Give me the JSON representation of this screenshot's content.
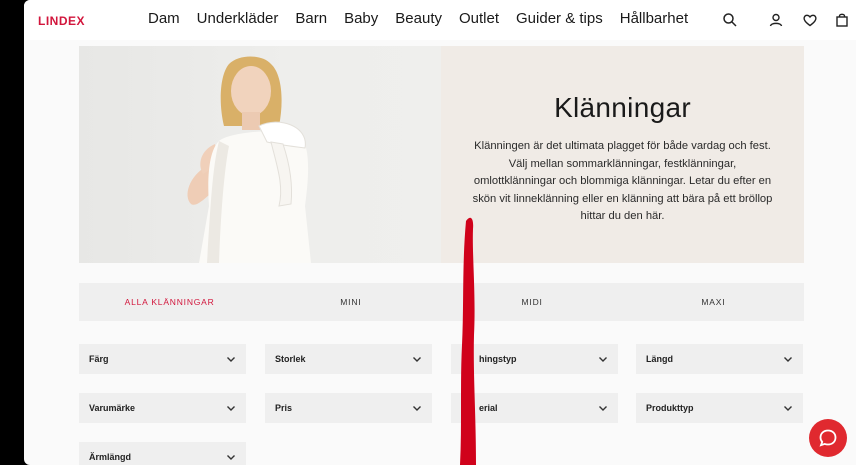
{
  "header": {
    "logo": "LINDEX",
    "nav": [
      "Dam",
      "Underkläder",
      "Barn",
      "Baby",
      "Beauty",
      "Outlet",
      "Guider & tips",
      "Hållbarhet"
    ]
  },
  "hero": {
    "title": "Klänningar",
    "description": "Klänningen är det ultimata plagget för både vardag och fest. Välj mellan sommarklänningar, festklänningar, omlottklänningar och blommiga klänningar. Letar du efter en skön vit linneklänning eller en klänning att bära på ett bröllop hittar du den här."
  },
  "tabs": [
    {
      "label": "ALLA KLÄNNINGAR",
      "active": true
    },
    {
      "label": "MINI",
      "active": false
    },
    {
      "label": "MIDI",
      "active": false
    },
    {
      "label": "MAXI",
      "active": false
    }
  ],
  "filters": [
    [
      "Färg",
      "Storlek",
      "hingstyp",
      "Längd"
    ],
    [
      "Varumärke",
      "Pris",
      "erial",
      "Produkttyp"
    ],
    [
      "Ärmlängd"
    ]
  ],
  "colors": {
    "brand": "#d2163c",
    "chat": "#e0292f",
    "hero_bg": "#f0ebe6",
    "filter_bg": "#efefef"
  },
  "icons": [
    "search-icon",
    "user-icon",
    "heart-icon",
    "bag-icon",
    "chevron-down-icon",
    "chat-icon"
  ]
}
